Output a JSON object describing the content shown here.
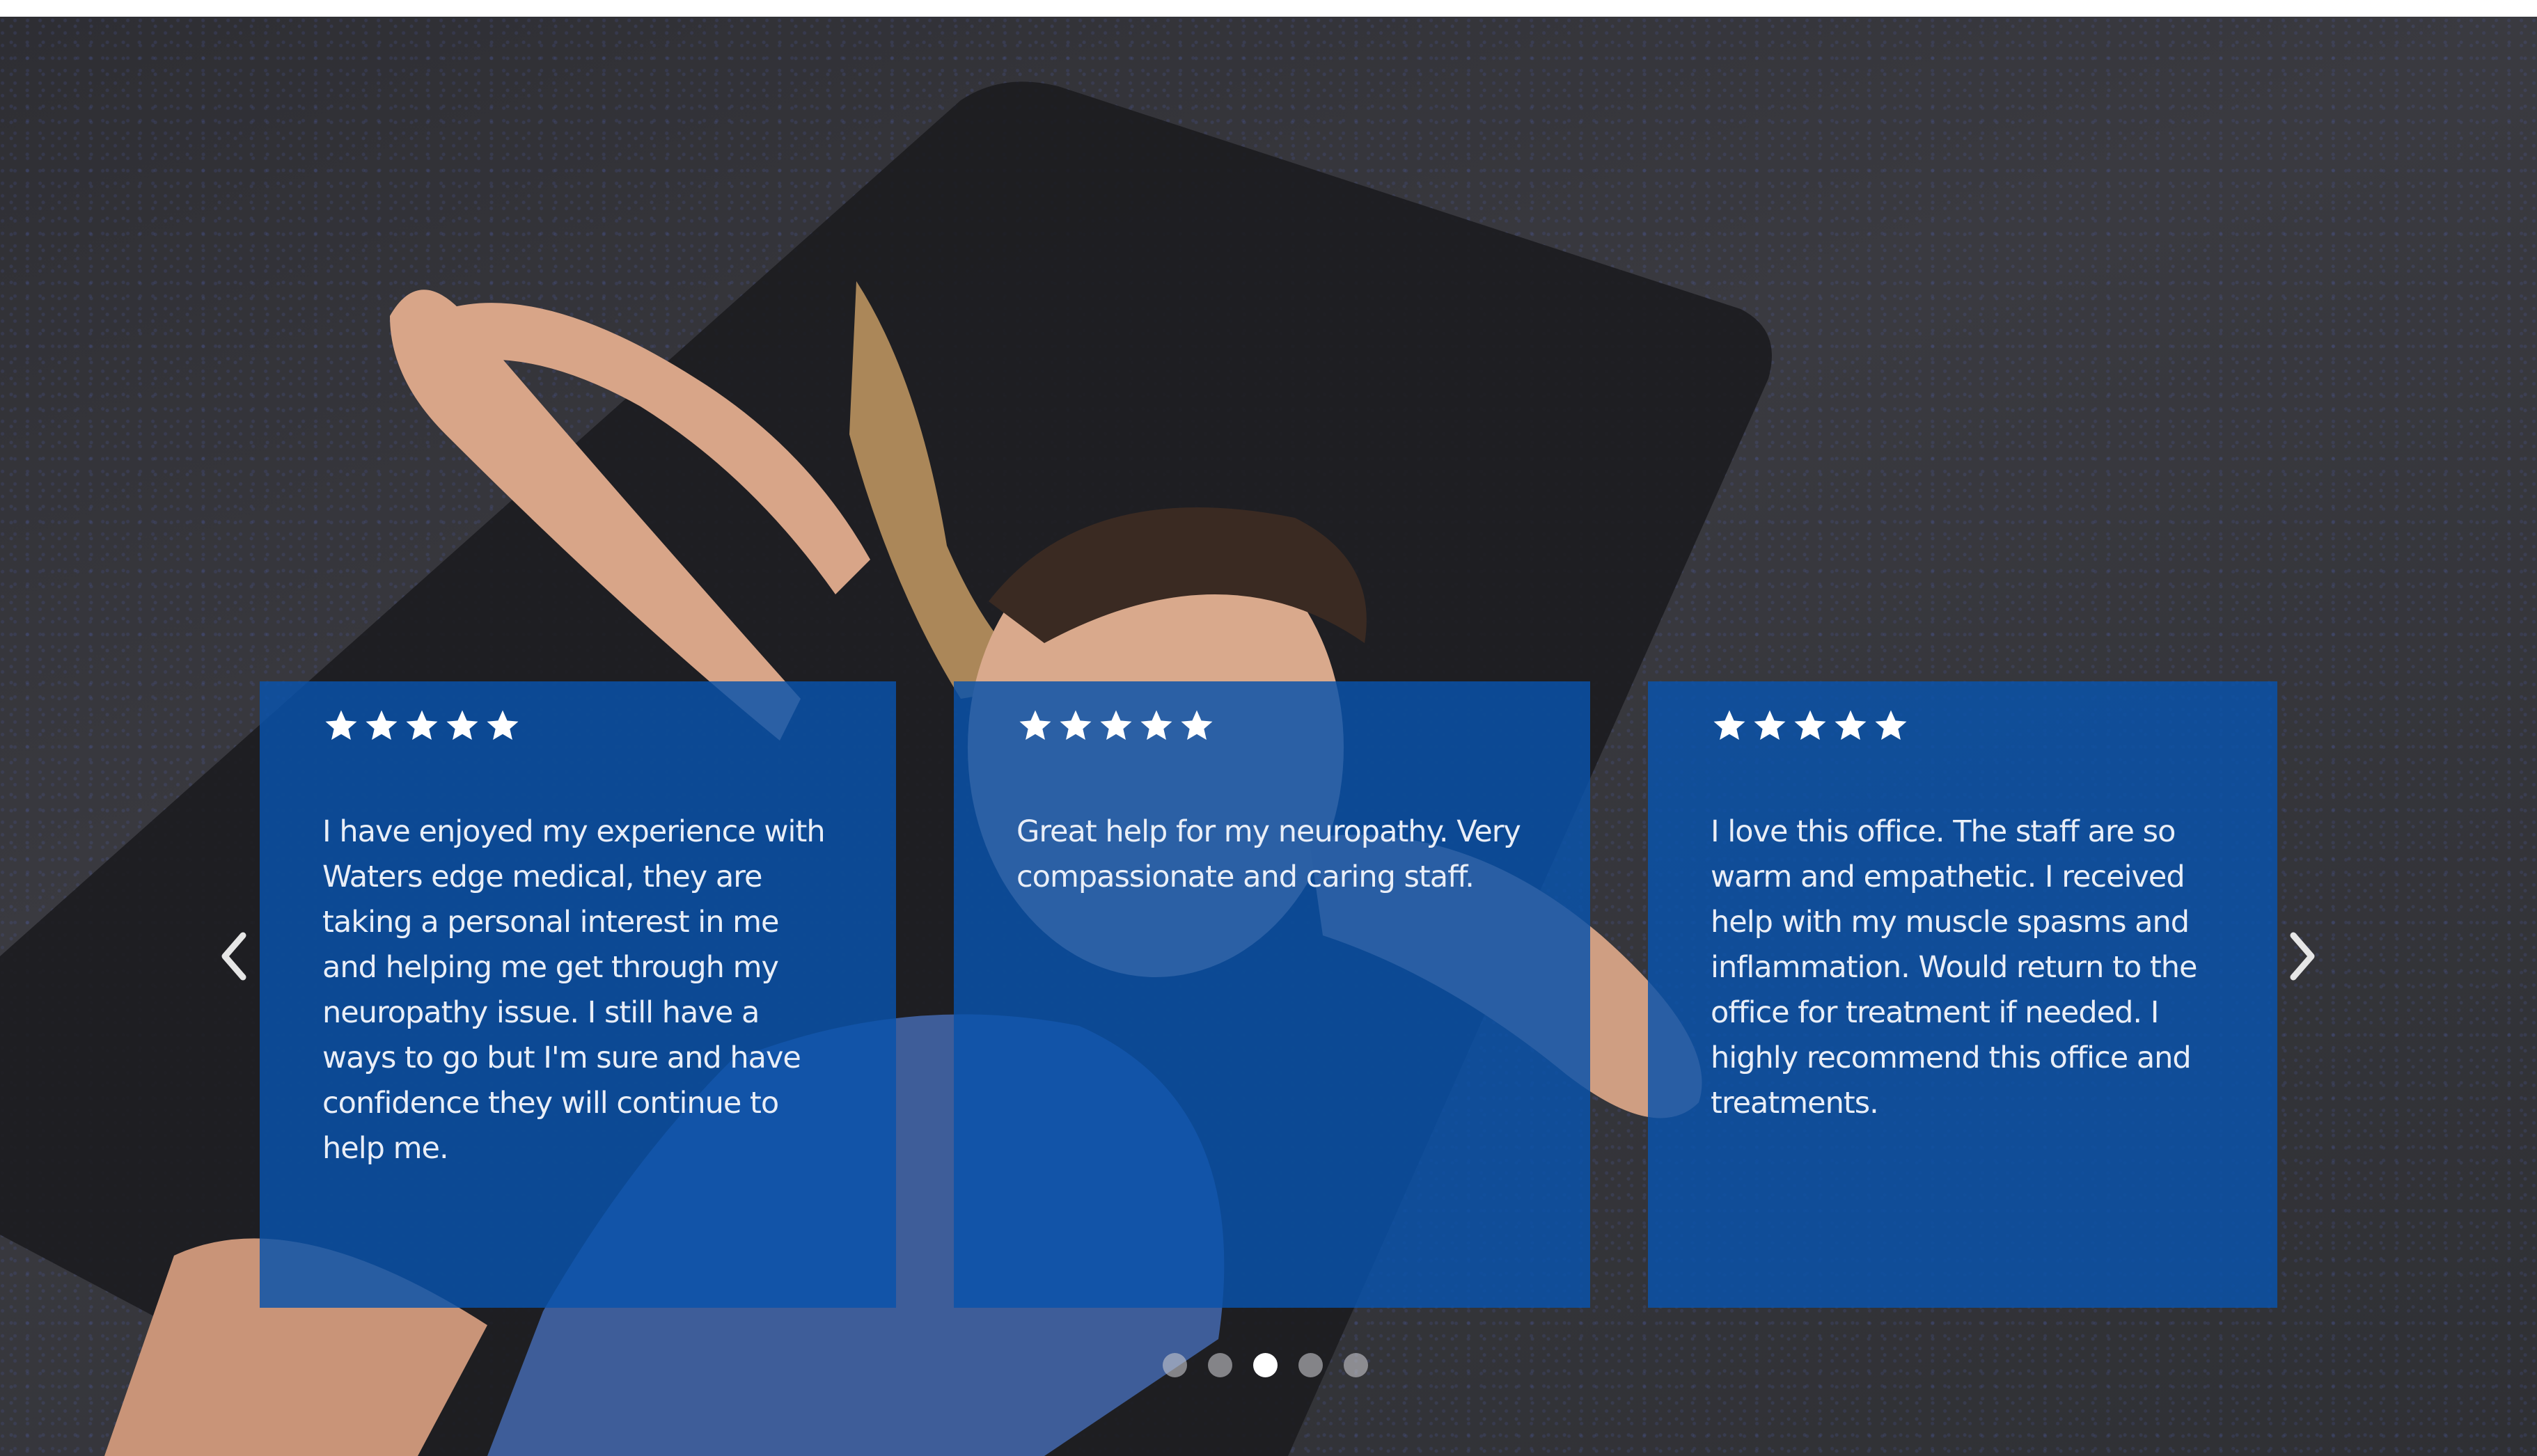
{
  "colors": {
    "card_background": "#0a52aa",
    "text": "#ffffff",
    "dot_inactive": "#c8c8cd",
    "dot_active": "#ffffff"
  },
  "background_image": "woman-lying-on-yoga-mat-photo",
  "carousel": {
    "prev_icon": "chevron-left-icon",
    "next_icon": "chevron-right-icon",
    "active_slide": 3,
    "slide_count": 5,
    "testimonials": [
      {
        "rating": 5,
        "text": "I have enjoyed my experience with Waters edge medical, they are taking a personal interest in me and helping me get through my neuropathy issue. I still have a ways to go but I'm sure and have confidence they will continue to help me."
      },
      {
        "rating": 5,
        "text": "Great help for my neuropathy. Very compassionate and caring staff."
      },
      {
        "rating": 5,
        "text": "I love this office. The staff are so warm and empathetic. I received help with my muscle spasms and inflammation. Would return to the office for treatment if needed. I highly recommend this office and treatments."
      }
    ]
  }
}
